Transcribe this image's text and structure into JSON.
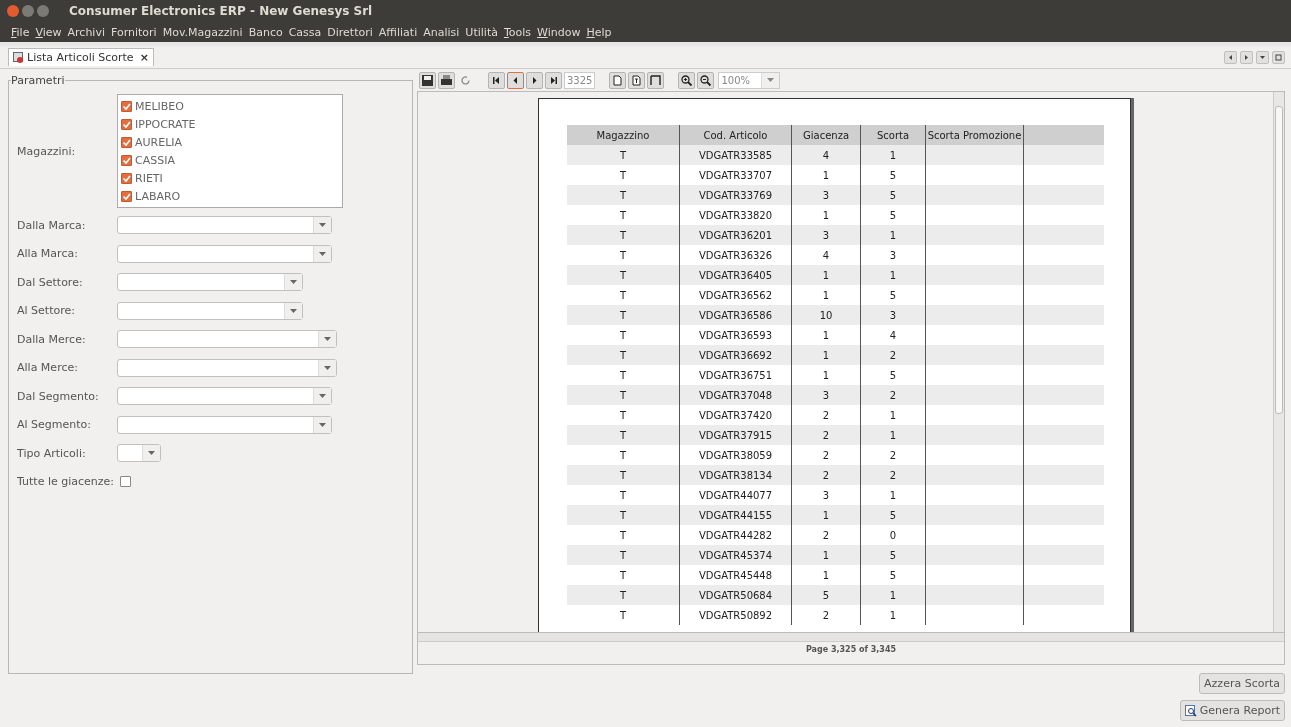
{
  "window": {
    "title": "Consumer Electronics ERP - New Genesys Srl"
  },
  "menu": [
    {
      "label": "File",
      "underline": true
    },
    {
      "label": "View",
      "underline": true
    },
    {
      "label": "Archivi",
      "underline": false
    },
    {
      "label": "Fornitori",
      "underline": false
    },
    {
      "label": "Mov.Magazzini",
      "underline": false
    },
    {
      "label": "Banco",
      "underline": false
    },
    {
      "label": "Cassa",
      "underline": false
    },
    {
      "label": "Direttori",
      "underline": false
    },
    {
      "label": "Affiliati",
      "underline": false
    },
    {
      "label": "Analisi",
      "underline": false
    },
    {
      "label": "Utilità",
      "underline": false
    },
    {
      "label": "Tools",
      "underline": true
    },
    {
      "label": "Window",
      "underline": true
    },
    {
      "label": "Help",
      "underline": true
    }
  ],
  "tab": {
    "label": "Lista Articoli Scorte",
    "close": "×"
  },
  "params": {
    "title": "Parametri",
    "magazzini_label": "Magazzini:",
    "magazzini": [
      {
        "label": "MELIBEO",
        "checked": true
      },
      {
        "label": "IPPOCRATE",
        "checked": true
      },
      {
        "label": "AURELIA",
        "checked": true
      },
      {
        "label": "CASSIA",
        "checked": true
      },
      {
        "label": "RIETI",
        "checked": true
      },
      {
        "label": "LABARO",
        "checked": true
      }
    ],
    "combos": [
      {
        "label": "Dalla Marca:"
      },
      {
        "label": "Alla Marca:"
      },
      {
        "label": "Dal Settore:"
      },
      {
        "label": "Al Settore:"
      },
      {
        "label": "Dalla Merce:"
      },
      {
        "label": "Alla Merce:"
      },
      {
        "label": "Dal Segmento:"
      },
      {
        "label": "Al Segmento:"
      },
      {
        "label": "Tipo Articoli:"
      }
    ],
    "tutte": {
      "label": "Tutte le giacenze:",
      "checked": false
    }
  },
  "toolbar": {
    "page": "3325",
    "zoom": "100%"
  },
  "report": {
    "columns": [
      "Magazzino",
      "Cod. Articolo",
      "Giacenza",
      "Scorta",
      "Scorta Promozione"
    ],
    "rows": [
      [
        "T",
        "VDGATR33585",
        "4",
        "1"
      ],
      [
        "T",
        "VDGATR33707",
        "1",
        "5"
      ],
      [
        "T",
        "VDGATR33769",
        "3",
        "5"
      ],
      [
        "T",
        "VDGATR33820",
        "1",
        "5"
      ],
      [
        "T",
        "VDGATR36201",
        "3",
        "1"
      ],
      [
        "T",
        "VDGATR36326",
        "4",
        "3"
      ],
      [
        "T",
        "VDGATR36405",
        "1",
        "1"
      ],
      [
        "T",
        "VDGATR36562",
        "1",
        "5"
      ],
      [
        "T",
        "VDGATR36586",
        "10",
        "3"
      ],
      [
        "T",
        "VDGATR36593",
        "1",
        "4"
      ],
      [
        "T",
        "VDGATR36692",
        "1",
        "2"
      ],
      [
        "T",
        "VDGATR36751",
        "1",
        "5"
      ],
      [
        "T",
        "VDGATR37048",
        "3",
        "2"
      ],
      [
        "T",
        "VDGATR37420",
        "2",
        "1"
      ],
      [
        "T",
        "VDGATR37915",
        "2",
        "1"
      ],
      [
        "T",
        "VDGATR38059",
        "2",
        "2"
      ],
      [
        "T",
        "VDGATR38134",
        "2",
        "2"
      ],
      [
        "T",
        "VDGATR44077",
        "3",
        "1"
      ],
      [
        "T",
        "VDGATR44155",
        "1",
        "5"
      ],
      [
        "T",
        "VDGATR44282",
        "2",
        "0"
      ],
      [
        "T",
        "VDGATR45374",
        "1",
        "5"
      ],
      [
        "T",
        "VDGATR45448",
        "1",
        "5"
      ],
      [
        "T",
        "VDGATR50684",
        "5",
        "1"
      ],
      [
        "T",
        "VDGATR50892",
        "2",
        "1"
      ]
    ],
    "page_info": "Page 3,325 of 3,345"
  },
  "buttons": [
    {
      "label": "Azzera Scorta",
      "kind": "plain"
    },
    {
      "label": "Genera Report",
      "kind": "report"
    }
  ]
}
